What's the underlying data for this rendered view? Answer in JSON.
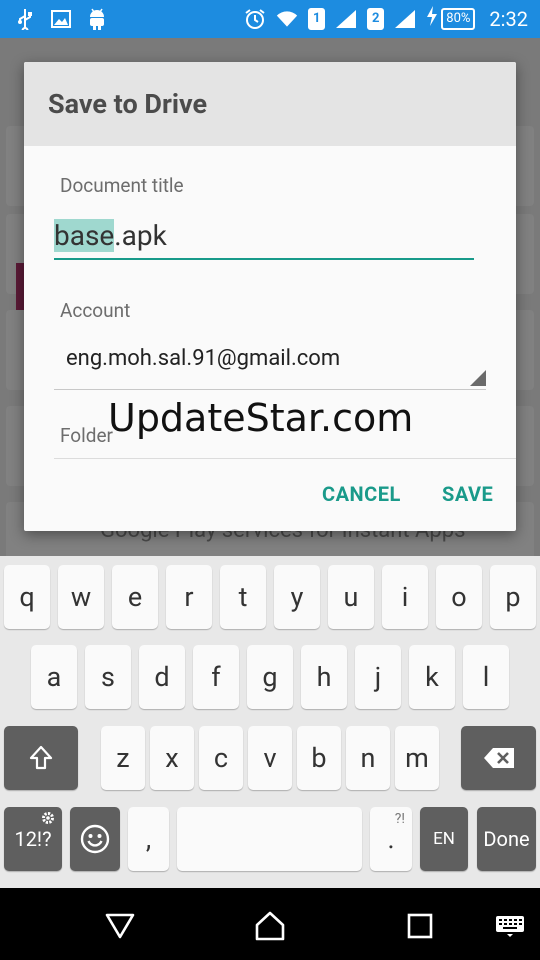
{
  "status_bar": {
    "sim1": "1",
    "sim2": "2",
    "battery": "80%",
    "time": "2:32"
  },
  "background": {
    "partial_text": "Google Play services for Instant Apps"
  },
  "dialog": {
    "title": "Save to Drive",
    "document_title_label": "Document title",
    "document_title_selected": "base",
    "document_title_rest": ".apk",
    "account_label": "Account",
    "account_value": "eng.moh.sal.91@gmail.com",
    "folder_label": "Folder",
    "cancel_label": "CANCEL",
    "save_label": "SAVE",
    "accent_color": "#189a8a"
  },
  "watermark": "UpdateStar.com",
  "keyboard": {
    "row1": [
      "q",
      "w",
      "e",
      "r",
      "t",
      "y",
      "u",
      "i",
      "o",
      "p"
    ],
    "row2": [
      "a",
      "s",
      "d",
      "f",
      "g",
      "h",
      "j",
      "k",
      "l"
    ],
    "row3": [
      "z",
      "x",
      "c",
      "v",
      "b",
      "n",
      "m"
    ],
    "symbols_label": "12!?",
    "comma_label": ",",
    "period_label": ".",
    "period_hint": "?!",
    "language_label": "EN",
    "done_label": "Done"
  }
}
